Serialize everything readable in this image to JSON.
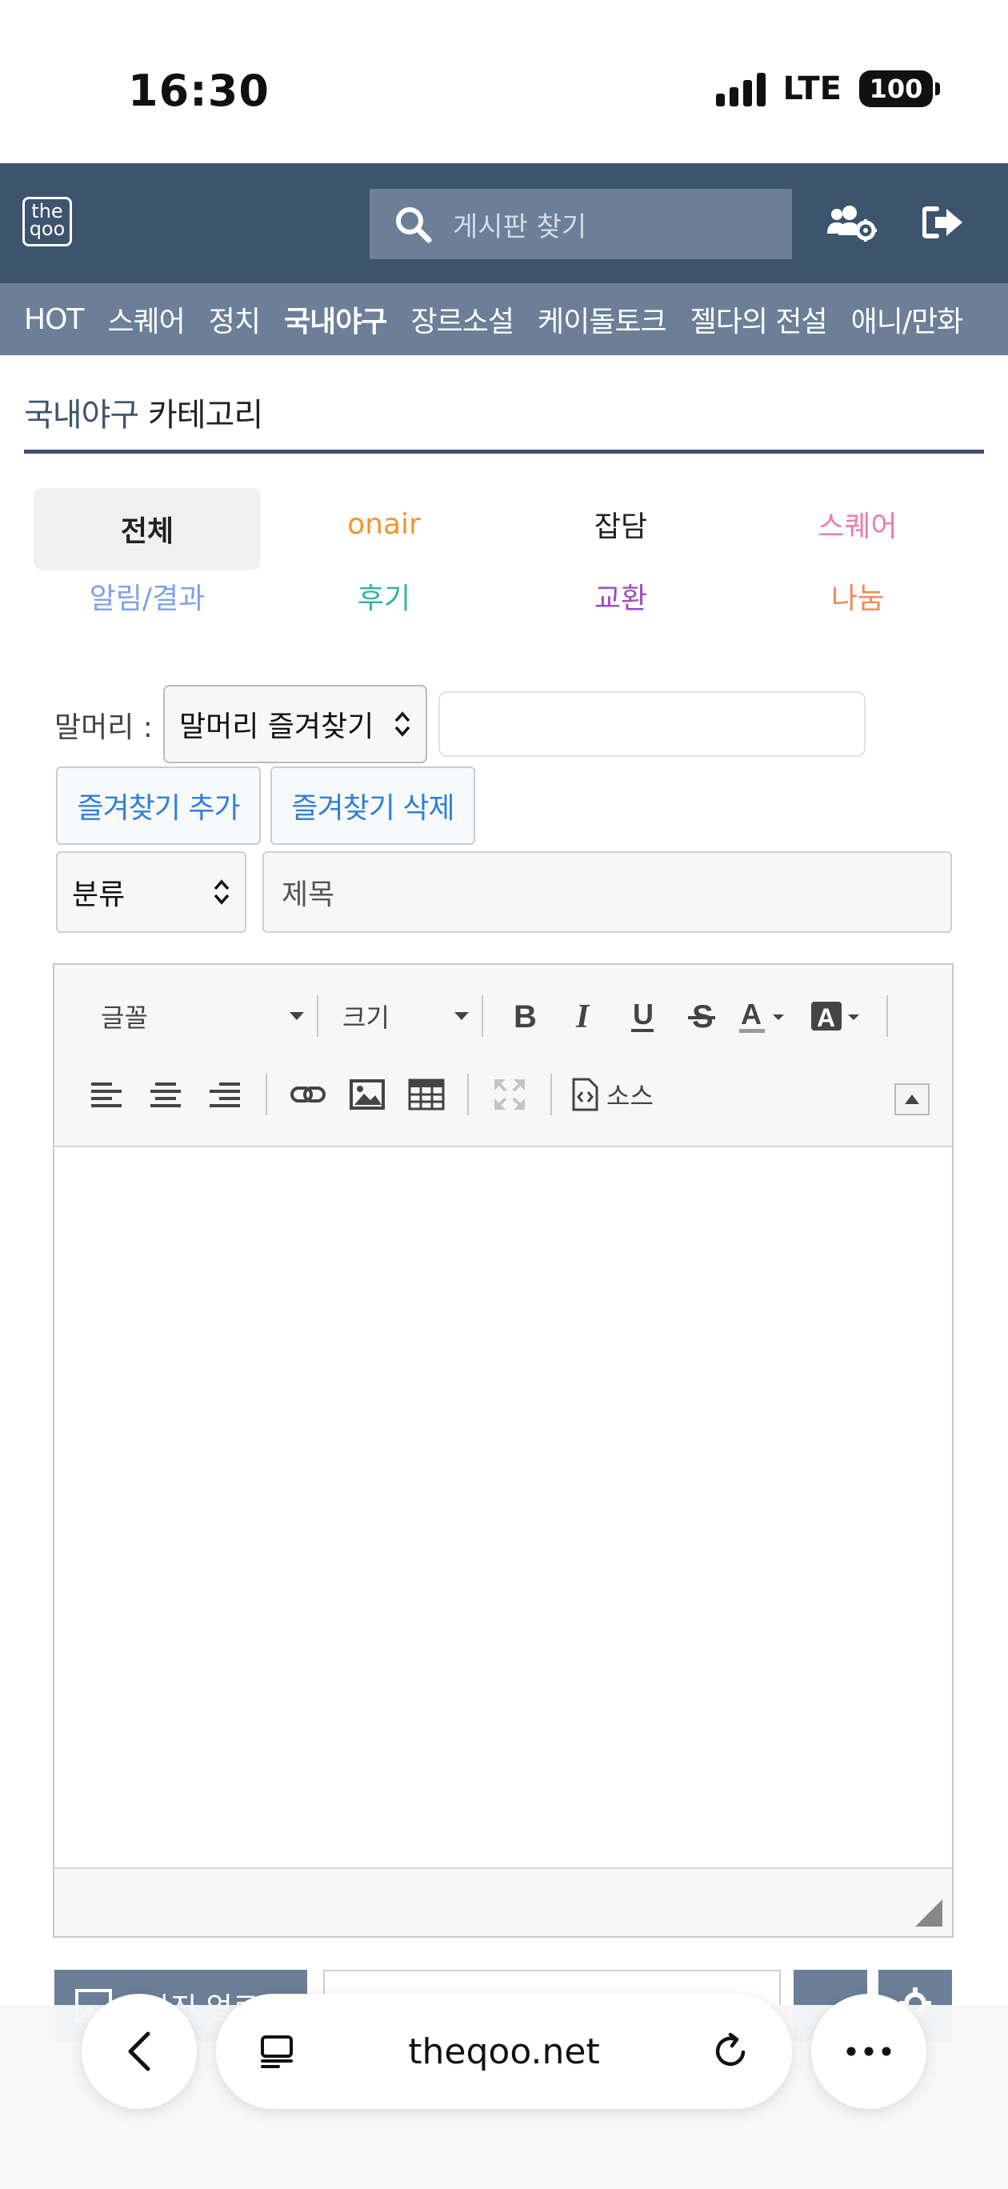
{
  "status_bar": {
    "time": "16:30",
    "network": "LTE",
    "battery": "100"
  },
  "header": {
    "logo_text": "the qoo",
    "search_placeholder": "게시판 찾기"
  },
  "nav": {
    "items": [
      "HOT",
      "스퀘어",
      "정치",
      "국내야구",
      "장르소설",
      "케이돌토크",
      "젤다의 전설",
      "애니/만화"
    ],
    "active": "국내야구"
  },
  "category": {
    "title_board": "국내야구",
    "title_suffix": " 카테고리",
    "items": [
      {
        "label": "전체",
        "color": "#222222",
        "selected": true
      },
      {
        "label": "onair",
        "color": "#f0962f"
      },
      {
        "label": "잡담",
        "color": "#222222"
      },
      {
        "label": "스퀘어",
        "color": "#f07ab0"
      },
      {
        "label": "알림/결과",
        "color": "#7ea2e8"
      },
      {
        "label": "후기",
        "color": "#35b59b"
      },
      {
        "label": "교환",
        "color": "#9b4fc0"
      },
      {
        "label": "나눔",
        "color": "#f08a5a"
      }
    ]
  },
  "form": {
    "prefix_label": "말머리 :",
    "prefix_select": "말머리 즐겨찾기",
    "prefix_input": "",
    "add_fav_button": "즐겨찾기 추가",
    "del_fav_button": "즐겨찾기 삭제",
    "category_select": "분류",
    "title_placeholder": "제목"
  },
  "editor": {
    "font_label": "글꼴",
    "size_label": "크기",
    "source_label": "소스"
  },
  "upload": {
    "button_label": "사진 업로드"
  },
  "browser": {
    "url": "theqoo.net"
  },
  "colors": {
    "header_bg": "#3d546f",
    "nav_bg": "#6c7f98",
    "link_blue": "#2f80d9"
  }
}
